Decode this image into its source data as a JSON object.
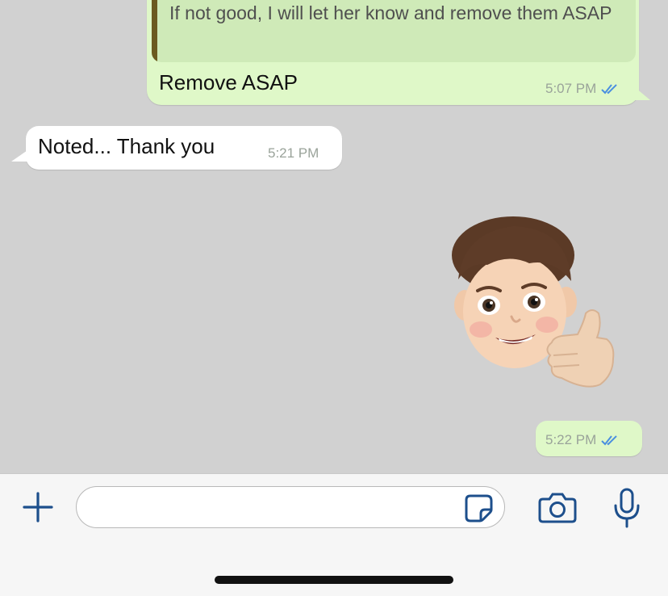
{
  "messages": {
    "outgoing_quote": {
      "quoted_text": "If not good, I will let her know and remove them ASAP",
      "text": "Remove ASAP",
      "time": "5:07 PM"
    },
    "incoming": {
      "text": "Noted... Thank you",
      "time": "5:21 PM"
    },
    "sticker": {
      "icon": "memoji-thumbs-up-sticker",
      "time": "5:22 PM"
    }
  },
  "input_bar": {
    "message_placeholder": "",
    "icons": [
      "plus-icon",
      "sticker-icon",
      "camera-icon",
      "microphone-icon"
    ]
  },
  "colors": {
    "chat_background": "#d1d1d1",
    "outgoing_bubble": "#dff8c8",
    "incoming_bubble": "#ffffff",
    "read_ticks": "#4a8fe0",
    "input_icons": "#1d4f8c"
  }
}
